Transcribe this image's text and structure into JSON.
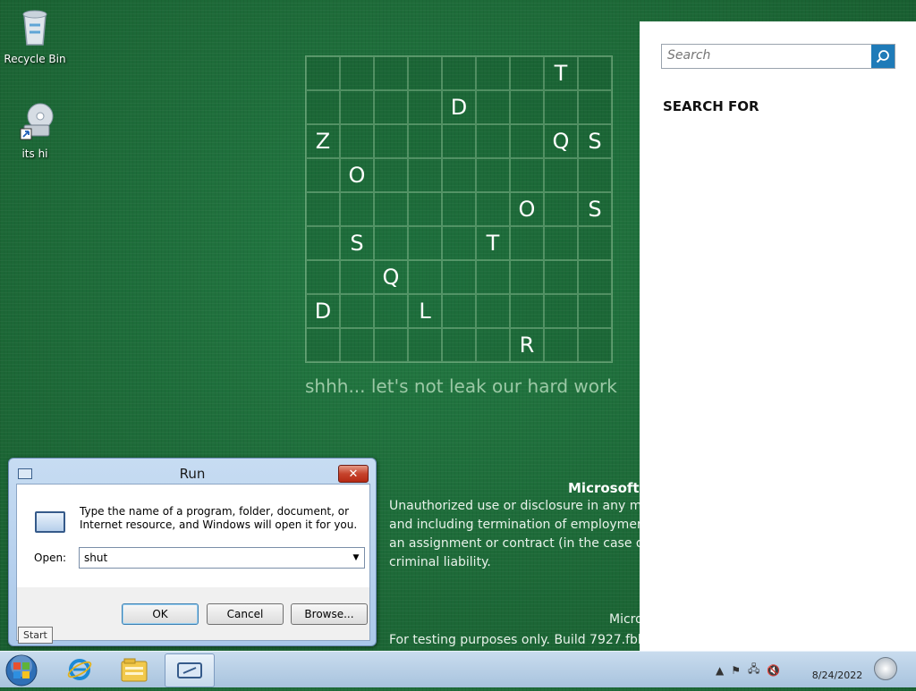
{
  "desktop": {
    "icons": [
      {
        "label": "Recycle Bin",
        "icon": "recycle-bin-icon"
      },
      {
        "label": "its hi",
        "icon": "disc-drive-shortcut-icon"
      }
    ],
    "grid_letters": [
      [
        "",
        "",
        "",
        "",
        "",
        "",
        "",
        "T",
        ""
      ],
      [
        "",
        "",
        "",
        "",
        "D",
        "",
        "",
        "",
        ""
      ],
      [
        "Z",
        "",
        "",
        "",
        "",
        "",
        "",
        "Q",
        "S"
      ],
      [
        "",
        "O",
        "",
        "",
        "",
        "",
        "",
        "",
        ""
      ],
      [
        "",
        "",
        "",
        "",
        "",
        "",
        "O",
        "",
        "S"
      ],
      [
        "",
        "S",
        "",
        "",
        "",
        "T",
        "",
        "",
        ""
      ],
      [
        "",
        "",
        "Q",
        "",
        "",
        "",
        "",
        "",
        ""
      ],
      [
        "D",
        "",
        "",
        "L",
        "",
        "",
        "",
        "",
        ""
      ],
      [
        "",
        "",
        "",
        "",
        "",
        "",
        "R",
        "",
        ""
      ]
    ],
    "tagline": "shhh... let's not leak our hard work",
    "notice_title": "Microsoft",
    "notice_body": "Unauthorized use or disclosure in any ma\nand including termination of employmen\nan assignment or contract (in the case of\ncriminal liability.",
    "footer_brand": "Micro",
    "footer_build": "For testing purposes only. Build 7927.fbl_"
  },
  "search_pane": {
    "placeholder": "Search",
    "heading": "SEARCH FOR"
  },
  "run_dialog": {
    "title": "Run",
    "description": "Type the name of a program, folder, document, or Internet resource, and Windows will open it for you.",
    "open_label": "Open:",
    "open_value": "shut",
    "ok_label": "OK",
    "cancel_label": "Cancel",
    "browse_label": "Browse...",
    "close_glyph": "✕",
    "dropdown_glyph": "▼"
  },
  "taskbar": {
    "start_tooltip": "Start",
    "pinned": [
      "internet-explorer-icon",
      "windows-explorer-icon",
      "run-icon"
    ],
    "tray": {
      "up_arrow": "▲",
      "flag": "⚑",
      "network": "🖧",
      "volume": "🔇"
    },
    "date": "8/24/2022"
  },
  "colors": {
    "desktop_green": "#1e6b3a",
    "search_button": "#1f7bb8",
    "close_red": "#c6432c"
  }
}
